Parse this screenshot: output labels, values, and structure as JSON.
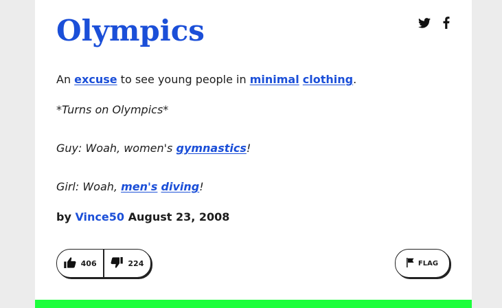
{
  "entry": {
    "word": "Olympics",
    "meaning": {
      "prefix": "An ",
      "link1": "excuse",
      "mid1": " to see young people in ",
      "link2": "minimal",
      "mid2": " ",
      "link3": "clothing",
      "suffix": "."
    },
    "examples": {
      "line1": "*Turns on Olympics*",
      "line2_prefix": "Guy: Woah, women's ",
      "line2_link": "gymnastics",
      "line2_suffix": "!",
      "line3_prefix": "Girl: Woah, ",
      "line3_link1": "men's",
      "line3_mid": " ",
      "line3_link2": "diving",
      "line3_suffix": "!"
    },
    "byline": {
      "prefix": "by ",
      "author": "Vince50",
      "date": " August 23, 2008"
    },
    "votes": {
      "up": "406",
      "down": "224"
    },
    "flag_label": "FLAG"
  },
  "share": {
    "twitter_icon": "twitter-icon",
    "facebook_icon": "facebook-icon"
  },
  "colors": {
    "link": "#1b4fd8",
    "accent_bar": "#1cff3c",
    "text": "#1c1c1c",
    "background": "#ececec"
  }
}
